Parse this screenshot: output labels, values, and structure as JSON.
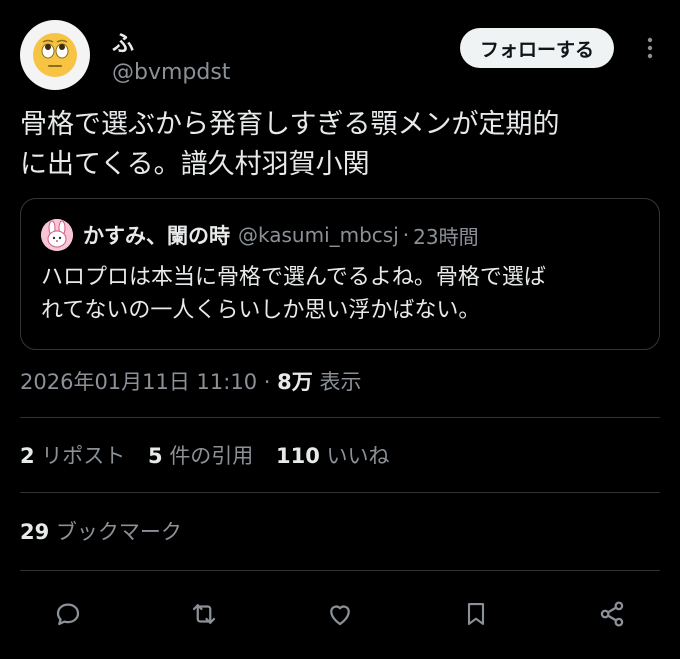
{
  "author": {
    "name": "ふ",
    "handle": "@bvmpdst",
    "avatar_icon": "face-with-rolling-eyes-emoji"
  },
  "follow_label": "フォローする",
  "more_icon": "more-vertical-icon",
  "tweet_text_lines": [
    "骨格で選ぶから発育しすぎる顎メンが定期的",
    "に出てくる。譜久村羽賀小関"
  ],
  "quote": {
    "name": "かすみ、闌の時",
    "handle": "@kasumi_mbcsj",
    "separator": "·",
    "time": "23時間",
    "text_lines": [
      "ハロプロは本当に骨格で選んでるよね。骨格で選ば",
      "れてないの一人くらいしか思い浮かばない。"
    ]
  },
  "meta": {
    "datetime": "2026年01月11日 11:10",
    "separator": "·",
    "views_count": "8万",
    "views_label": "表示"
  },
  "stats": {
    "reposts_count": "2",
    "reposts_label": "リポスト",
    "quotes_count": "5",
    "quotes_label": "件の引用",
    "likes_count": "110",
    "likes_label": "いいね"
  },
  "bookmarks": {
    "count": "29",
    "label": "ブックマーク"
  },
  "actions": [
    "reply-icon",
    "repost-icon",
    "like-icon",
    "bookmark-icon",
    "share-icon"
  ],
  "colors": {
    "background": "#000000",
    "text": "#e7e9ea",
    "muted": "#8b9197",
    "border": "#2f3336",
    "button_bg": "#eff3f4"
  }
}
